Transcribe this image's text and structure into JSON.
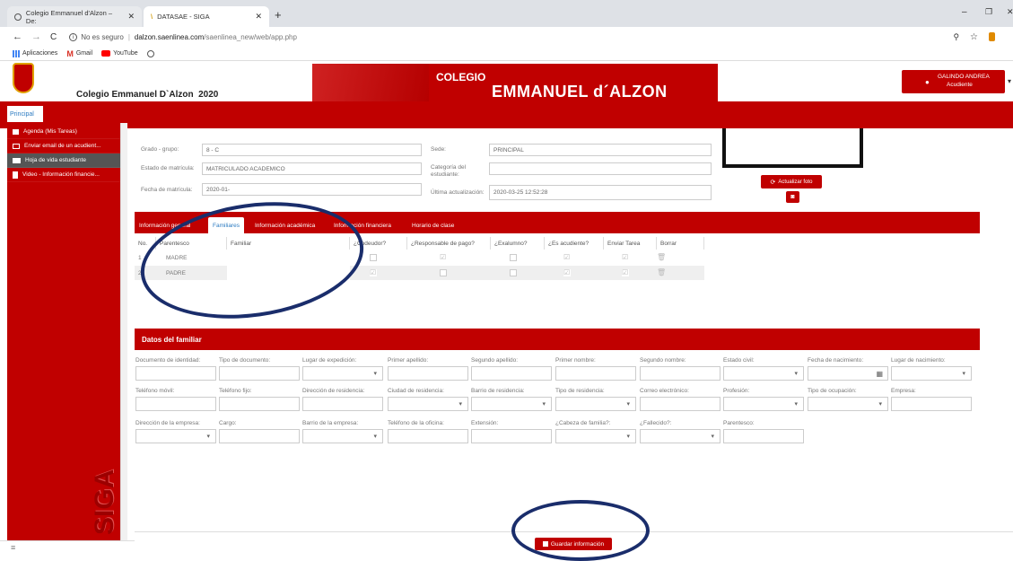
{
  "browser": {
    "tabs": [
      {
        "title": "Colegio Emmanuel d'Alzon – De:",
        "active": false
      },
      {
        "title": "DATASAE - SIGA",
        "active": true
      }
    ],
    "not_secure": "No es seguro",
    "url_domain": "dalzon.saenlinea.com",
    "url_path": "/saenlinea_new/web/app.php",
    "bookmarks": [
      "Aplicaciones",
      "Gmail",
      "YouTube"
    ]
  },
  "header": {
    "school_name": "Colegio Emmanuel D`Alzon  2020",
    "banner_top": "COLEGIO",
    "banner_main": "EMMANUEL d´ALZON",
    "user_name": "GALINDO ANDREA",
    "user_role": "Acudiente"
  },
  "sidebar": {
    "tab": "Principal",
    "items": [
      {
        "label": "Agenda (Mis Tareas)",
        "icon": "book-icon"
      },
      {
        "label": "Enviar email de un acudient...",
        "icon": "mail-icon"
      },
      {
        "label": "Hoja de vida estudiante",
        "icon": "id-card-icon"
      },
      {
        "label": "Video - Información financie...",
        "icon": "file-icon"
      }
    ],
    "brand": "SIGA"
  },
  "panel": {
    "title": "Hoja de vida estudiante",
    "close": "×"
  },
  "student": {
    "grado_label": "Grado - grupo:",
    "grado_value": "8 - C",
    "estado_label": "Estado de matrícula:",
    "estado_value": "MATRICULADO ACADEMICO",
    "fecha_label": "Fecha de matrícula:",
    "fecha_value": "2020-01-",
    "sede_label": "Sede:",
    "sede_value": "PRINCIPAL",
    "categoria_label": "Categoría del estudiante:",
    "categoria_value": "",
    "ultima_label": "Última actualización:",
    "ultima_value": "2020-03-25 12:52:28",
    "update_photo": "Actualizar foto"
  },
  "tabs": [
    "Información general",
    "Familiares",
    "Información académica",
    "Información financiera",
    "Horario de clase"
  ],
  "family_table": {
    "headers": [
      "No.",
      "Parentesco",
      "Familiar",
      "¿Codeudor?",
      "¿Responsable de pago?",
      "¿Exalumno?",
      "¿Es acudiente?",
      "Enviar Tarea",
      "Borrar"
    ],
    "rows": [
      {
        "no": "1",
        "parentesco": "MADRE",
        "familiar": ""
      },
      {
        "no": "2",
        "parentesco": "PADRE",
        "familiar": ""
      }
    ]
  },
  "familiar_form": {
    "title": "Datos del familiar",
    "row1": [
      "Documento de identidad:",
      "Tipo de documento:",
      "Lugar de expedición:",
      "Primer apellido:",
      "Segundo apellido:",
      "Primer nombre:",
      "Segundo nombre:",
      "Estado civil:",
      "Fecha de nacimiento:",
      "Lugar de nacimiento:"
    ],
    "row2": [
      "Teléfono móvil:",
      "Teléfono fijo:",
      "Dirección de residencia:",
      "Ciudad de residencia:",
      "Barrio de residencia:",
      "Tipo de residencia:",
      "Correo electrónico:",
      "Profesión:",
      "Tipo de ocupación:",
      "Empresa:"
    ],
    "row3": [
      "Dirección de la empresa:",
      "Cargo:",
      "Barrio de la empresa:",
      "Teléfono de la oficina:",
      "Extensión:",
      "¿Cabeza de familia?:",
      "¿Fallecido?:",
      "Parentesco:"
    ]
  },
  "save_button": "Guardar información",
  "colors": {
    "brand_red": "#c00000",
    "annotation": "#1a2d6b",
    "link_blue": "#2c7bc1"
  }
}
